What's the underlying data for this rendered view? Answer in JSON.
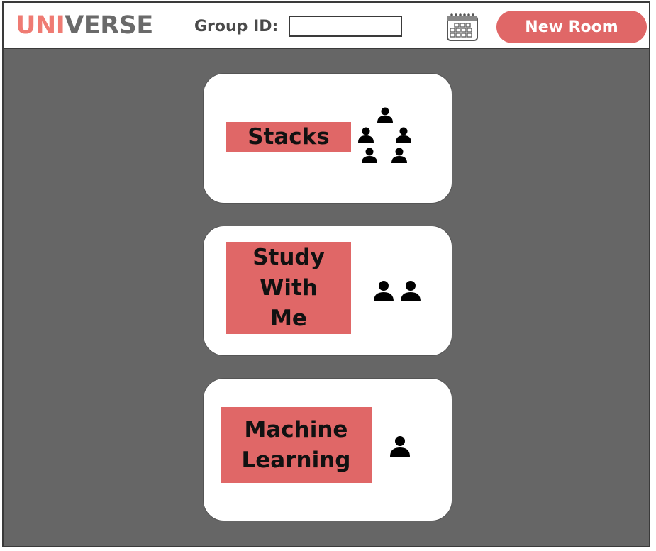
{
  "header": {
    "logo_part1": "UNI",
    "logo_part2": "VERSE",
    "group_id_label": "Group ID:",
    "group_id_value": "",
    "calendar_icon": "calendar-icon",
    "new_room_label": "New Room"
  },
  "colors": {
    "accent": "#e06767",
    "logo_accent": "#ef7b73",
    "logo_gray": "#6a6a6a",
    "background": "#666666"
  },
  "rooms": [
    {
      "name": "Stacks",
      "icon": "group-icon",
      "member_icon_count": 5
    },
    {
      "name": "Study\nWith\nMe",
      "icon": "pair-icon",
      "member_icon_count": 2
    },
    {
      "name": "Machine\nLearning",
      "icon": "person-icon",
      "member_icon_count": 1
    }
  ]
}
